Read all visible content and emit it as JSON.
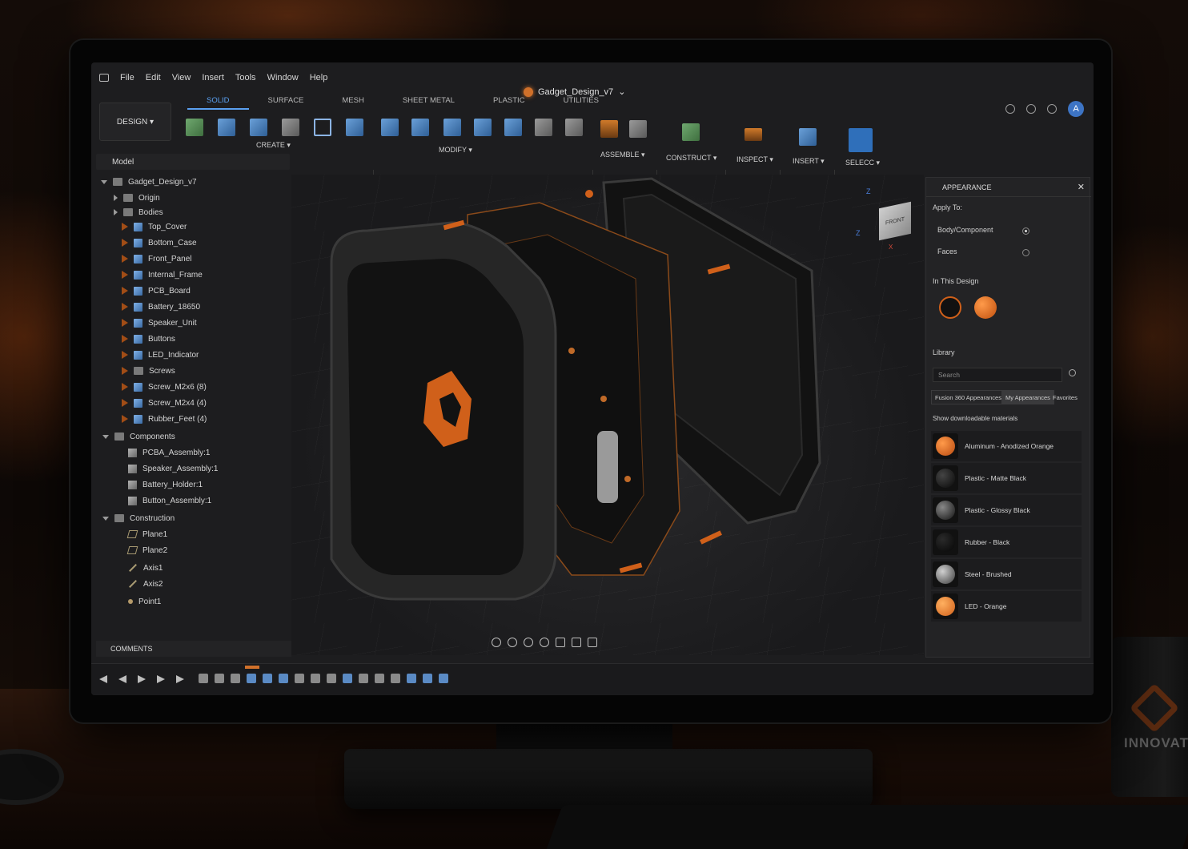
{
  "menu": [
    "File",
    "Edit",
    "View",
    "Insert",
    "Tools",
    "Window",
    "Help"
  ],
  "document_title": "Gadget_Design_v7",
  "workspace_button": "DESIGN ▾",
  "tabs": [
    "SOLID",
    "SURFACE",
    "MESH",
    "SHEET METAL",
    "PLASTIC",
    "UTILITIES"
  ],
  "tool_groups": {
    "create": "CREATE ▾",
    "modify": "MODIFY ▾",
    "assemble": "ASSEMBLE ▾",
    "construct": "CONSTRUCT ▾",
    "inspect": "INSPECT ▾",
    "insert": "INSERT ▾",
    "select": "SELECС ▾"
  },
  "avatar_letter": "A",
  "browser": {
    "header": "Model",
    "root": "Gadget_Design_v7",
    "items": [
      "Origin",
      "Bodies",
      "Top_Cover",
      "Bottom_Case",
      "Front_Panel",
      "Internal_Frame",
      "PCB_Board",
      "Battery_18650",
      "Speaker_Unit",
      "Buttons",
      "LED_Indicator",
      "Screws",
      "Screw_M2x6 (8)",
      "Screw_M2x4 (4)",
      "Rubber_Feet (4)"
    ],
    "components_label": "Components",
    "components": [
      "PCBA_Assembly:1",
      "Speaker_Assembly:1",
      "Battery_Holder:1",
      "Button_Assembly:1"
    ],
    "construction_label": "Construction",
    "construction": [
      "Plane1",
      "Plane2",
      "Axis1",
      "Axis2",
      "Point1"
    ]
  },
  "viewcube": {
    "top": "Z",
    "left": "Z",
    "right": "X",
    "faces": [
      "FRONT",
      "FRONT"
    ]
  },
  "appearance": {
    "title": "APPEARANCE",
    "apply_to_label": "Apply To:",
    "apply_options": [
      "Body/Component",
      "Faces"
    ],
    "selected_apply": "Body/Component",
    "in_design_label": "In This Design",
    "library_label": "Library",
    "search_placeholder": "Search",
    "library_tabs": [
      "Fusion 360 Appearances",
      "My Appearances",
      "Favorites"
    ],
    "show_downloadable": "Show downloadable materials",
    "materials": [
      {
        "name": "Aluminum - Anodized Orange",
        "color": "#d0601a"
      },
      {
        "name": "Plastic - Matte Black",
        "color": "#151515"
      },
      {
        "name": "Plastic - Glossy Black",
        "color": "#2a2a2a"
      },
      {
        "name": "Rubber - Black",
        "color": "#101010"
      },
      {
        "name": "Steel - Brushed",
        "color": "#7a7a7a"
      },
      {
        "name": "LED - Orange",
        "color": "#e07020"
      }
    ]
  },
  "comments_label": "COMMENTS",
  "mug_text": "INNOVATE",
  "colors": {
    "accent": "#d0702a",
    "selection_blue": "#5aa0f0"
  }
}
